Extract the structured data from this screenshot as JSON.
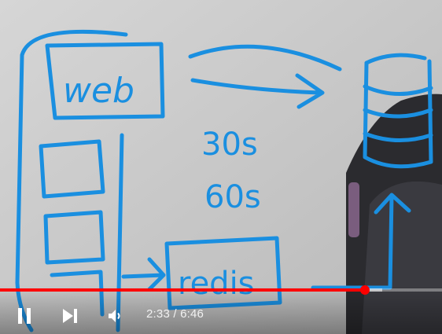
{
  "video": {
    "current_time": "2:33",
    "duration": "6:46",
    "separator": " / ",
    "progress_fraction": 0.8256
  },
  "whiteboard": {
    "box_top_label": "web",
    "interval_1": "30s",
    "interval_2": "60s",
    "box_bottom_label": "redis",
    "ink_color": "#1a8fe0"
  },
  "player": {
    "accent_color": "#ff0000",
    "icons": [
      "pause-icon",
      "next-icon",
      "volume-icon"
    ]
  }
}
